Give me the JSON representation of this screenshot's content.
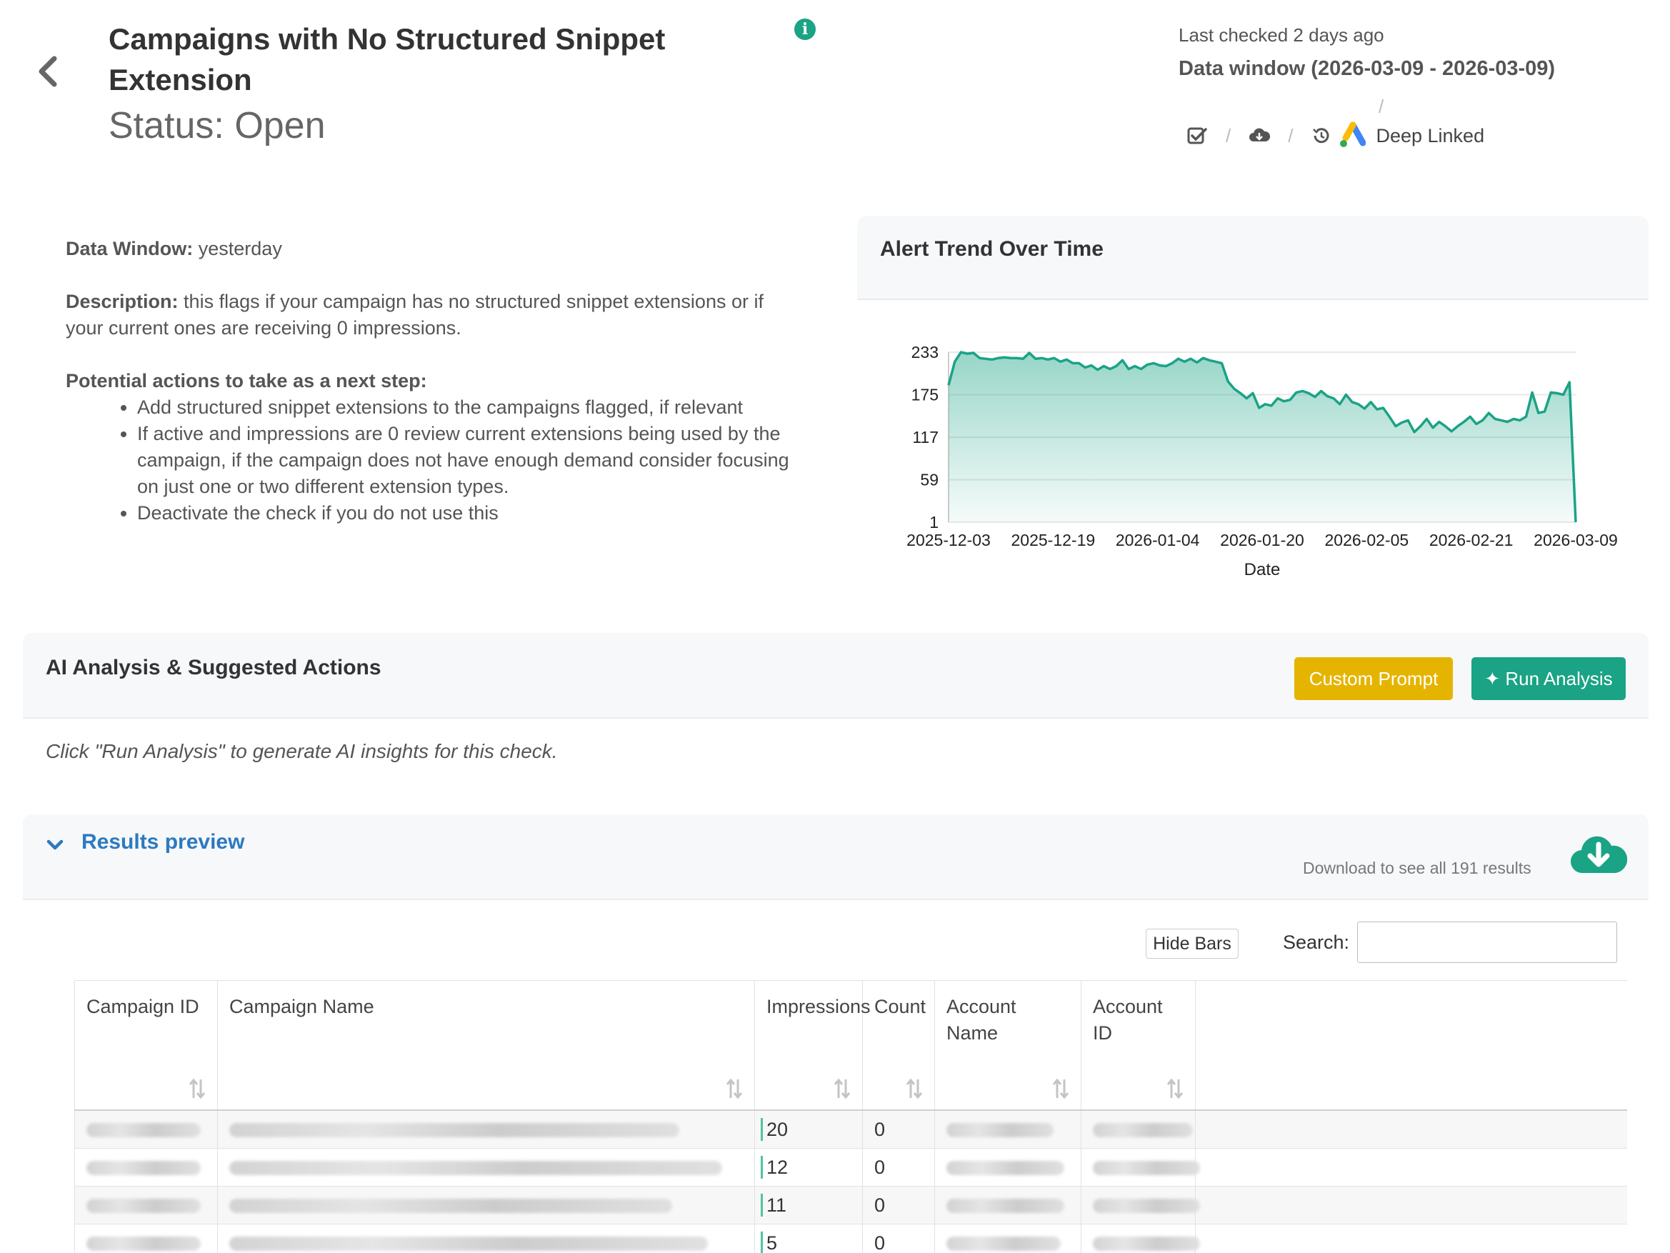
{
  "header": {
    "title": "Campaigns with No Structured Snippet Extension",
    "status": "Status: Open",
    "last_checked": "Last checked 2 days ago",
    "data_window": "Data window (2026-03-09 - 2026-03-09)",
    "deep_linked": "Deep Linked"
  },
  "description": {
    "data_window_label": "Data Window:",
    "data_window_value": "yesterday",
    "desc_label": "Description:",
    "desc_value": "this flags if your campaign has no structured snippet extensions or if your current ones are receiving 0 impressions.",
    "actions_label": "Potential actions to take as a next step:",
    "actions": [
      "Add structured snippet extensions to the campaigns flagged, if relevant",
      "If active and impressions are 0 review current extensions being used by the campaign, if the campaign does not have enough demand consider focusing on just one or two different extension types.",
      "Deactivate the check if you do not use this"
    ]
  },
  "chart_card": {
    "title": "Alert Trend Over Time"
  },
  "chart_data": {
    "type": "area",
    "title": "Alert Trend Over Time",
    "xlabel": "Date",
    "ylabel": "",
    "x_ticks": [
      "2025-12-03",
      "2025-12-19",
      "2026-01-04",
      "2026-01-20",
      "2026-02-05",
      "2026-02-21",
      "2026-03-09"
    ],
    "y_ticks": [
      1,
      59,
      117,
      175,
      233
    ],
    "ylim": [
      1,
      233
    ],
    "x_start": "2025-12-03",
    "x_end": "2026-03-09",
    "series_color": "#1aa385",
    "values": [
      188,
      220,
      233,
      231,
      232,
      225,
      224,
      223,
      225,
      226,
      225,
      225,
      224,
      232,
      224,
      225,
      223,
      225,
      220,
      223,
      218,
      218,
      212,
      215,
      209,
      214,
      210,
      214,
      222,
      210,
      214,
      210,
      216,
      218,
      215,
      214,
      218,
      224,
      220,
      224,
      219,
      225,
      222,
      220,
      218,
      193,
      183,
      177,
      170,
      177,
      157,
      162,
      160,
      170,
      166,
      168,
      178,
      180,
      177,
      172,
      180,
      173,
      170,
      162,
      175,
      165,
      162,
      156,
      165,
      155,
      157,
      145,
      132,
      137,
      140,
      124,
      132,
      142,
      130,
      138,
      132,
      125,
      132,
      138,
      145,
      135,
      140,
      150,
      142,
      140,
      138,
      142,
      140,
      145,
      178,
      150,
      152,
      178,
      177,
      175,
      192,
      1
    ]
  },
  "ai": {
    "title": "AI Analysis & Suggested Actions",
    "custom_prompt": "Custom Prompt",
    "run_analysis": "✦ Run Analysis",
    "hint": "Click \"Run Analysis\" to generate AI insights for this check."
  },
  "results": {
    "title": "Results preview",
    "download_text": "Download to see all 191 results",
    "hide_bars": "Hide Bars",
    "search_label": "Search:",
    "search_value": "",
    "columns": [
      "Campaign ID",
      "Campaign Name",
      "Impressions",
      "Count",
      "Account Name",
      "Account ID"
    ],
    "rows": [
      {
        "impressions": "20",
        "count": "0"
      },
      {
        "impressions": "12",
        "count": "0"
      },
      {
        "impressions": "11",
        "count": "0"
      },
      {
        "impressions": "5",
        "count": "0"
      }
    ]
  }
}
